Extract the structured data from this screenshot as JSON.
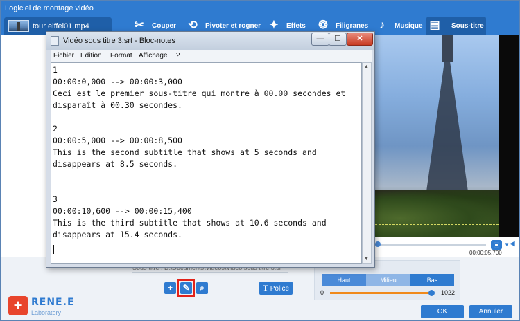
{
  "app": {
    "title": "Logiciel de montage vidéo",
    "file_tab": "tour eiffel01.mp4",
    "window_buttons": [
      "—",
      "☐",
      "✕"
    ]
  },
  "toolbar": [
    {
      "label": "Couper",
      "icon": "scissors-icon"
    },
    {
      "label": "Pivoter et rogner",
      "icon": "rotate-crop-icon"
    },
    {
      "label": "Effets",
      "icon": "effects-icon"
    },
    {
      "label": "Filigranes",
      "icon": "watermark-icon"
    },
    {
      "label": "Musique",
      "icon": "music-icon"
    },
    {
      "label": "Sous-titre",
      "icon": "subtitle-icon",
      "active": true
    }
  ],
  "player": {
    "timecode": "00:00:05.700"
  },
  "subtitle_panel": {
    "path_text": "Sous-titre :  D:\\Documents\\Videos\\Vidéo sous titre 3.srt",
    "font_button": "Police",
    "font_button_icon": "T"
  },
  "position": {
    "options": [
      "Haut",
      "Milieu",
      "Bas"
    ],
    "selected": "Bas",
    "slider_min": "0",
    "slider_max": "1022",
    "slider_value_fraction": 0.95
  },
  "footer": {
    "brand": "RENE.E",
    "brand_sub": "Laboratory",
    "ok": "OK",
    "cancel": "Annuler"
  },
  "notepad": {
    "title": "Vidéo sous titre 3.srt - Bloc-notes",
    "menu": [
      "Fichier",
      "Edition",
      "Format",
      "Affichage",
      "?"
    ],
    "lines": [
      "1",
      "00:00:0,000 --> 00:00:3,000",
      "Ceci est le premier sous-titre qui montre à 00.00 secondes et",
      "disparaît à 00.30 secondes.",
      "",
      "2",
      "00:00:5,000 --> 00:00:8,500",
      "This is the second subtitle that shows at 5 seconds and",
      "disappears at 8.5 seconds.",
      "",
      "",
      "3",
      "00:00:10,600 --> 00:00:15,400",
      "This is the third subtitle that shows at 10.6 seconds and",
      "disappears at 15.4 seconds."
    ]
  },
  "colors": {
    "accent": "#2f7bd0",
    "highlight_border": "#e2231a",
    "slider_track": "#f08a1c"
  }
}
